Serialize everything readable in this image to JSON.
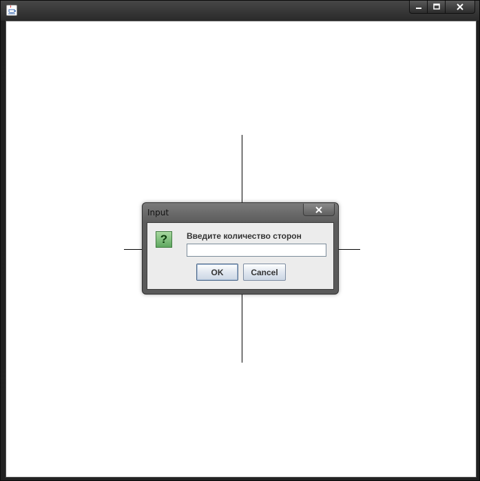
{
  "window": {
    "title": "",
    "controls": {
      "minimize": "minimize-icon",
      "maximize": "maximize-icon",
      "close": "close-icon"
    }
  },
  "dialog": {
    "title": "Input",
    "icon": "question-icon",
    "icon_glyph": "?",
    "prompt": "Введите количество сторон",
    "input": {
      "value": "",
      "placeholder": ""
    },
    "buttons": {
      "ok": "OK",
      "cancel": "Cancel"
    }
  },
  "colors": {
    "accent": "#4f6a8a",
    "question_icon": "#5fa860"
  }
}
